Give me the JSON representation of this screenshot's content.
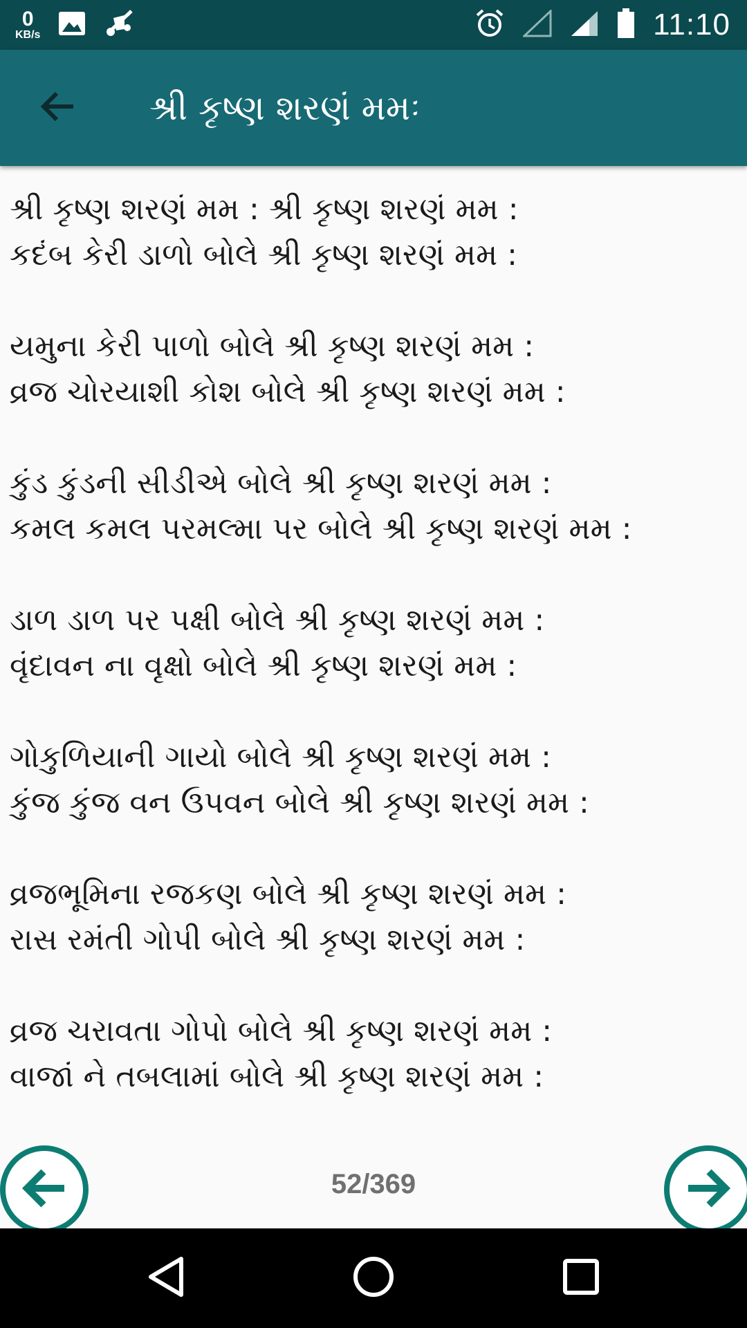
{
  "status_bar": {
    "net_speed_value": "0",
    "net_speed_unit": "KB/s",
    "time": "11:10",
    "icons": [
      "image-icon",
      "mute-icon",
      "alarm-icon",
      "signal-empty-icon",
      "signal-icon",
      "battery-icon"
    ]
  },
  "app_bar": {
    "back_icon": "arrow-left-icon",
    "title": "શ્રી કૃષ્ણ શરણં મમઃ"
  },
  "lyrics": [
    {
      "lines": [
        "શ્રી કૃષ્ણ શરણં મમ : શ્રી કૃષ્ણ શરણં મમ :",
        "કદંબ કેરી ડાળો બોલે શ્રી કૃષ્ણ શરણં મમ :"
      ]
    },
    {
      "lines": [
        "યમુના કેરી પાળો બોલે શ્રી કૃષ્ણ શરણં મમ :",
        "વ્રજ ચોરયાશી કોશ બોલે શ્રી કૃષ્ણ શરણં મમ :"
      ]
    },
    {
      "lines": [
        "કુંડ કુંડની સીડીએ બોલે શ્રી કૃષ્ણ શરણં મમ :",
        "કમલ કમલ પરમલ્મા પર બોલે શ્રી કૃષ્ણ શરણં મમ :"
      ]
    },
    {
      "lines": [
        "ડાળ ડાળ પર પક્ષી બોલે શ્રી કૃષ્ણ શરણં મમ :",
        "વૃંદાવન ના વૃક્ષો બોલે શ્રી કૃષ્ણ શરણં મમ :"
      ]
    },
    {
      "lines": [
        "ગોકુળિયાની ગાયો બોલે શ્રી કૃષ્ણ શરણં મમ :",
        "કુંજ કુંજ વન ઉપવન બોલે શ્રી કૃષ્ણ શરણં મમ :"
      ]
    },
    {
      "lines": [
        "વ્રજભૂમિના રજકણ બોલે શ્રી કૃષ્ણ શરણં મમ :",
        "રાસ રમંતી ગોપી બોલે શ્રી કૃષ્ણ શરણં મમ :"
      ]
    },
    {
      "lines": [
        "વ્રજ ચરાવતા ગોપો બોલે શ્રી કૃષ્ણ શરણં મમ :",
        "વાજાં ને તબલામાં બોલે શ્રી કૃષ્ણ શરણં મમ :"
      ]
    }
  ],
  "pager": {
    "counter": "52/369",
    "prev_icon": "circle-arrow-left-icon",
    "next_icon": "circle-arrow-right-icon",
    "accent_color": "#0d7d73"
  },
  "colors": {
    "status_bar": "#0b4a4f",
    "app_bar": "#176a73",
    "background": "#fafafa"
  },
  "system_nav": {
    "icons": [
      "back-triangle-icon",
      "home-circle-icon",
      "recents-square-icon"
    ]
  }
}
